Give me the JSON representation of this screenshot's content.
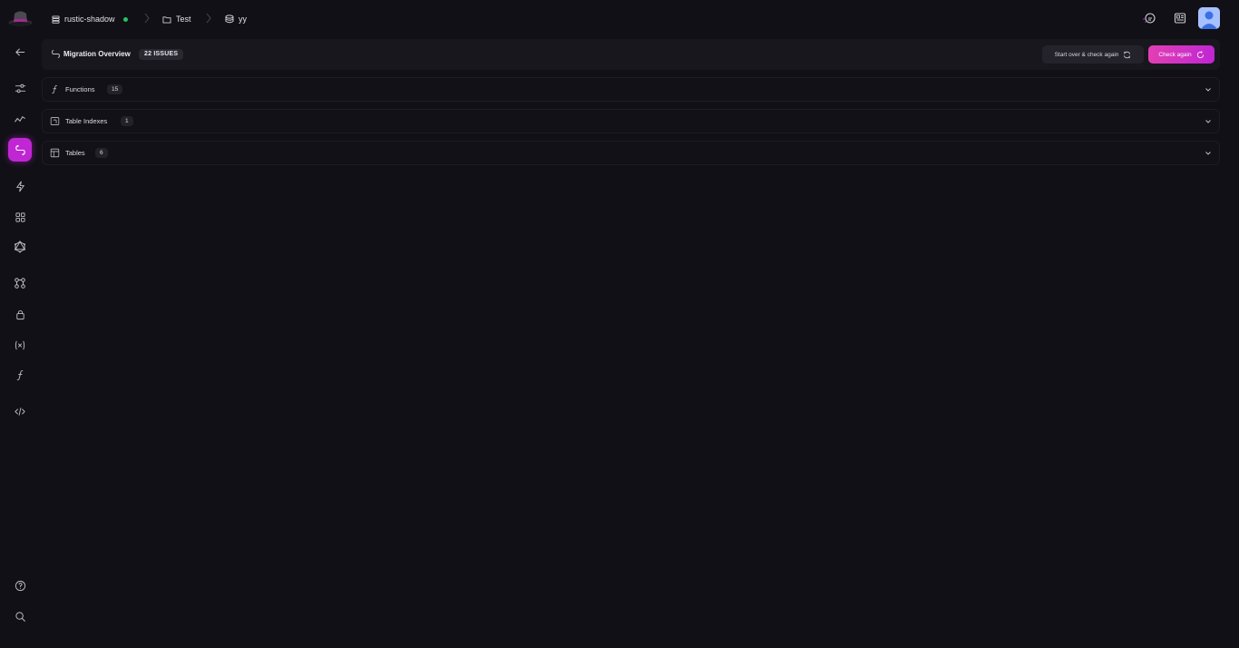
{
  "breadcrumb": {
    "project": "rustic-shadow",
    "folder": "Test",
    "database": "yy",
    "status_color": "#22c55e"
  },
  "overview": {
    "title": "Migration Overview",
    "issues_badge": "22 ISSUES",
    "start_over_label": "Start over & check again",
    "check_again_label": "Check again"
  },
  "sections": [
    {
      "label": "Functions",
      "count": "15",
      "icon": "function-icon"
    },
    {
      "label": "Table Indexes",
      "count": "1",
      "icon": "index-icon"
    },
    {
      "label": "Tables",
      "count": "6",
      "icon": "table-icon"
    }
  ],
  "sidebar": {
    "active_item": "migration",
    "items": [
      "back",
      "settings",
      "metrics",
      "migration",
      "events",
      "apps",
      "graphql",
      "schema",
      "security",
      "variables",
      "functions",
      "embed",
      "help",
      "search"
    ]
  },
  "colors": {
    "accent": "#c026d3",
    "background": "#111016",
    "panel": "#18171e"
  }
}
